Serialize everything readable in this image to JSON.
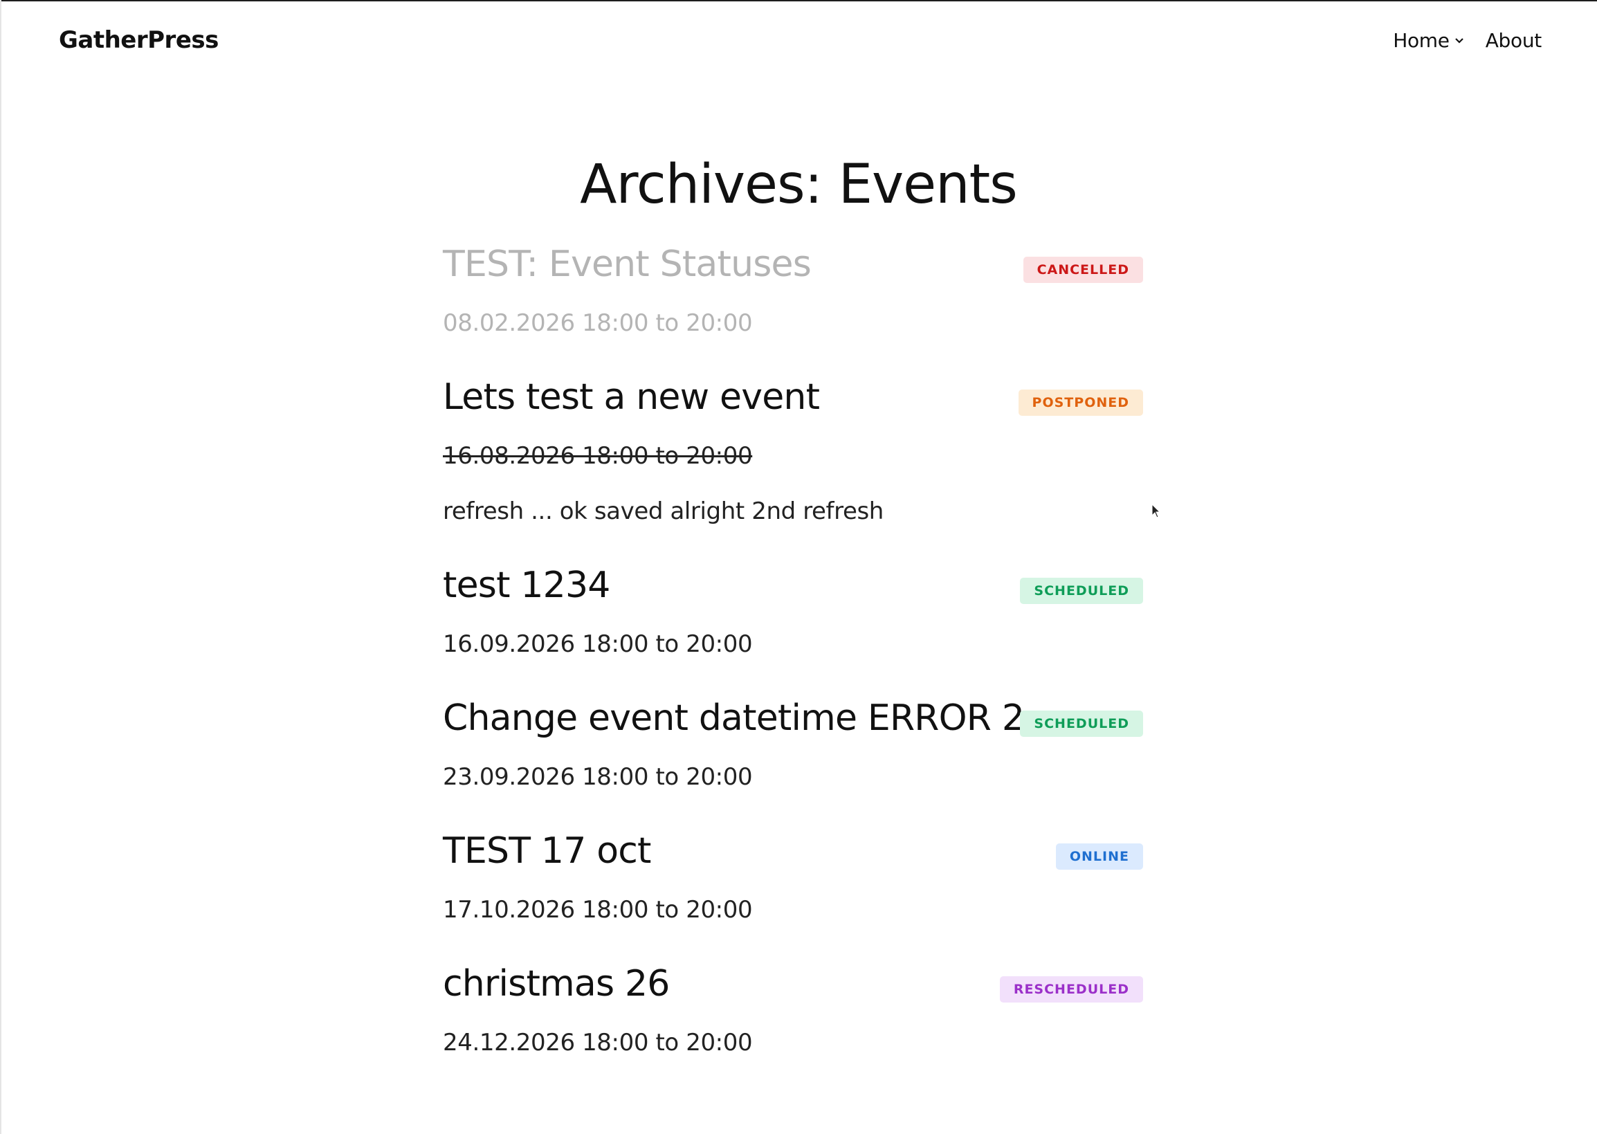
{
  "header": {
    "site_title": "GatherPress",
    "nav": [
      {
        "label": "Home",
        "has_submenu": true
      },
      {
        "label": "About",
        "has_submenu": false
      }
    ]
  },
  "main": {
    "page_title": "Archives: Events",
    "events": [
      {
        "title": "TEST: Event Statuses",
        "date": "08.02.2026 18:00 to 20:00",
        "status": "CANCELLED",
        "status_color": "#cc1818",
        "status_bg": "#fbe0e2",
        "excerpt": ""
      },
      {
        "title": "Lets test a new event",
        "date": "16.08.2026 18:00 to 20:00",
        "status": "POSTPONED",
        "status_color": "#e0620e",
        "status_bg": "#fdebd3",
        "excerpt": "refresh ... ok saved alright 2nd refresh"
      },
      {
        "title": "test 1234",
        "date": "16.09.2026 18:00 to 20:00",
        "status": "SCHEDULED",
        "status_color": "#0f9d58",
        "status_bg": "#d6f5e4",
        "excerpt": ""
      },
      {
        "title": "Change event datetime ERROR 2",
        "date": "23.09.2026 18:00 to 20:00",
        "status": "SCHEDULED",
        "status_color": "#0f9d58",
        "status_bg": "#d6f5e4",
        "excerpt": ""
      },
      {
        "title": "TEST 17 oct",
        "date": "17.10.2026 18:00 to 20:00",
        "status": "ONLINE",
        "status_color": "#1f6fd0",
        "status_bg": "#dbeafe",
        "excerpt": ""
      },
      {
        "title": "christmas 26",
        "date": "24.12.2026 18:00 to 20:00",
        "status": "RESCHEDULED",
        "status_color": "#9b30c9",
        "status_bg": "#f2e0fb",
        "excerpt": ""
      }
    ]
  }
}
